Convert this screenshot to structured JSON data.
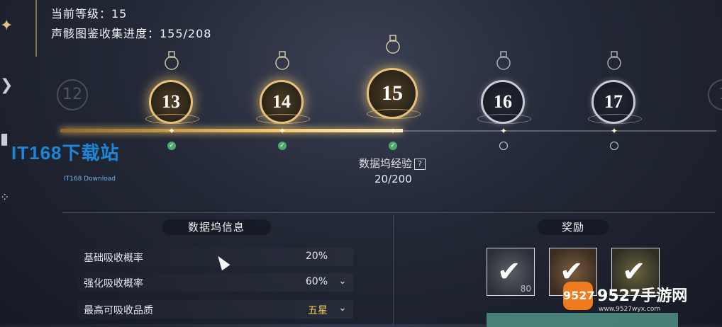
{
  "header": {
    "current_level": "当前等级：15",
    "collection_progress": "声骸图鉴收集进度：155/208"
  },
  "levels": [
    {
      "num": "12",
      "state": "ghost"
    },
    {
      "num": "13",
      "state": "done"
    },
    {
      "num": "14",
      "state": "done"
    },
    {
      "num": "15",
      "state": "current"
    },
    {
      "num": "16",
      "state": "locked"
    },
    {
      "num": "17",
      "state": "locked"
    },
    {
      "num": "1",
      "state": "ghost"
    }
  ],
  "experience": {
    "label": "数据坞经验",
    "help_icon": "?",
    "value": "20/200"
  },
  "info_panel": {
    "title": "数据坞信息",
    "rows": [
      {
        "key": "基础吸收概率",
        "value": "20%"
      },
      {
        "key": "强化吸收概率",
        "value": "60%"
      },
      {
        "key": "最高可吸收品质",
        "value": "五星"
      }
    ]
  },
  "rewards_panel": {
    "title": "奖励",
    "items": [
      {
        "icon": "check-icon",
        "qty": "80"
      },
      {
        "icon": "check-icon",
        "qty": ""
      },
      {
        "icon": "check-icon",
        "qty": ""
      }
    ]
  },
  "watermarks": {
    "it168_logo": "IT168下载站",
    "it168_sub": "IT168 Download",
    "site_badge": "9527",
    "site_name": "9527手游网",
    "site_url": "www.9527wyx.com"
  },
  "colors": {
    "accent_gold": "#f3c46d",
    "quality_gold": "#f4cf59",
    "done_green": "#4fa86c"
  }
}
